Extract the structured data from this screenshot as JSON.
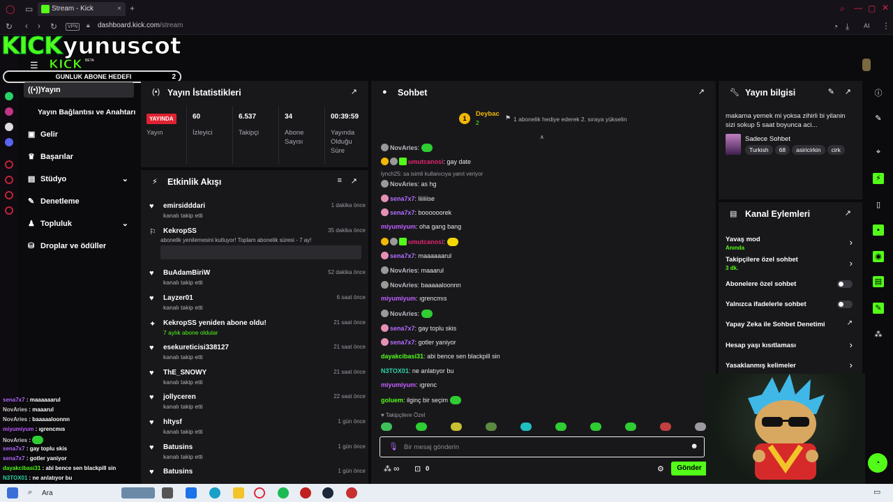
{
  "browser": {
    "tab_title": "Stream - Kick Dashboard",
    "url_domain": "dashboard.kick.com",
    "url_path": "/stream",
    "vpn_label": "VPN",
    "ai_label": "AI"
  },
  "overlay": {
    "logo_text": "KICK",
    "streamer_name": "yunuscot",
    "small_logo": "KICK",
    "beta": "BETA",
    "sub_goal_label": "GUNLUK ABONE HEDEFI",
    "sub_goal_count": "2"
  },
  "sidebar": {
    "items": [
      {
        "label": "Yayın",
        "icon": "broadcast-icon"
      },
      {
        "label": "Yayın Bağlantısı ve Anahtarı",
        "icon": ""
      },
      {
        "label": "Gelir",
        "icon": "money-icon"
      },
      {
        "label": "Başarılar",
        "icon": "trophy-icon"
      },
      {
        "label": "Stüdyo",
        "icon": "studio-icon"
      },
      {
        "label": "Denetleme",
        "icon": "wrench-icon"
      },
      {
        "label": "Topluluk",
        "icon": "community-icon"
      },
      {
        "label": "Droplar ve ödüller",
        "icon": "drops-icon"
      }
    ]
  },
  "stats": {
    "title": "Yayın İstatistikleri",
    "live_badge": "YAYINDA",
    "live_label": "Yayın",
    "viewers": "60",
    "viewers_label": "İzleyici",
    "followers": "6.537",
    "followers_label": "Takipçi",
    "subs": "34",
    "subs_label": "Abone Sayısı",
    "uptime": "00:39:59",
    "uptime_label": "Yayında Olduğu Süre"
  },
  "activity": {
    "title": "Etkinlik Akışı",
    "items": [
      {
        "name": "emirsidddari",
        "sub": "kanalı takip etti",
        "time": "1 dakika önce"
      },
      {
        "name": "KekropSS",
        "sub": "abonelik yenilemesini kutluyor! Toplam abonelik süresi - 7 ay!",
        "time": "35 dakika önce"
      },
      {
        "name": "BuAdamBiriW",
        "sub": "kanalı takip etti",
        "time": "52 dakika önce"
      },
      {
        "name": "Layzer01",
        "sub": "kanalı takip etti",
        "time": "6 saat önce"
      },
      {
        "name": "KekropSS yeniden abone oldu!",
        "sub": "7 aylık abone oldular",
        "time": "21 saat önce"
      },
      {
        "name": "esekureticisi338127",
        "sub": "kanalı takip etti",
        "time": "21 saat önce"
      },
      {
        "name": "ThE_SNOWY",
        "sub": "kanalı takip etti",
        "time": "21 saat önce"
      },
      {
        "name": "jollyceren",
        "sub": "kanalı takip etti",
        "time": "22 saat önce"
      },
      {
        "name": "hltysf",
        "sub": "kanalı takip etti",
        "time": "1 gün önce"
      },
      {
        "name": "Batusins",
        "sub": "kanalı takip etti",
        "time": "1 gün önce"
      },
      {
        "name": "Batusins",
        "sub": "",
        "time": "1 gün önce"
      }
    ]
  },
  "chat": {
    "title": "Sohbet",
    "pinned_user": "Deybac",
    "pinned_count": "2",
    "pinned_rank": "1",
    "pinned_text": "1 abonelik hediye ederek 2. sıraya yükselin",
    "reply_hint": "lynch25: sa isimli kullanıcıya yanıt veriyor",
    "messages": [
      {
        "user": "NovAries",
        "text": "",
        "color": "#b8b8c0"
      },
      {
        "user": "umutcanosi",
        "text": "gay date",
        "color": "#e0256e"
      },
      {
        "user": "NovAries",
        "text": "as hg",
        "color": "#b8b8c0"
      },
      {
        "user": "sena7x7",
        "text": "liiiiiise",
        "color": "#b46cff"
      },
      {
        "user": "sena7x7",
        "text": "boooooorek",
        "color": "#b46cff"
      },
      {
        "user": "miyumiyum",
        "text": "oha gang bang",
        "color": "#c060ff"
      },
      {
        "user": "umutcanosi",
        "text": "",
        "color": "#e0256e"
      },
      {
        "user": "sena7x7",
        "text": "maaaaaarul",
        "color": "#b46cff"
      },
      {
        "user": "NovAries",
        "text": "maaarul",
        "color": "#b8b8c0"
      },
      {
        "user": "NovAries",
        "text": "baaaaaloonnn",
        "color": "#b8b8c0"
      },
      {
        "user": "miyumiyum",
        "text": "ıgrencmıs",
        "color": "#c060ff"
      },
      {
        "user": "NovAries",
        "text": "",
        "color": "#b8b8c0"
      },
      {
        "user": "sena7x7",
        "text": "gay toplu skis",
        "color": "#b46cff"
      },
      {
        "user": "sena7x7",
        "text": "gotler yaniyor",
        "color": "#b46cff"
      },
      {
        "user": "dayakcibasi31",
        "text": "abi bence sen blackpill sin",
        "color": "#53fc18"
      },
      {
        "user": "N3TOX01",
        "text": "ne anlatıyor bu",
        "color": "#2fd4a8"
      },
      {
        "user": "miyumiyum",
        "text": "ıgrenc",
        "color": "#c060ff"
      },
      {
        "user": "goluem",
        "text": "ilginç bir seçim",
        "color": "#53fc18"
      }
    ],
    "followers_only": "Takipçilere Özel",
    "input_placeholder": "Bir mesaj gönderin",
    "points": "0",
    "send_label": "Gönder"
  },
  "stream_info": {
    "title": "Yayın bilgisi",
    "stream_title": "makarna yemek mi yoksa zihirli bi yilanin sizi sokup 5 saat boyunca aci...",
    "category": "Sadece Sohbet",
    "tags": [
      "Turkish",
      "68",
      "asiricirkin",
      "cirk"
    ]
  },
  "channel_actions": {
    "title": "Kanal Eylemleri",
    "slow_mode": "Yavaş mod",
    "slow_mode_sub": "Anında",
    "followers_chat": "Takipçilere özel sohbet",
    "followers_chat_sub": "3 dk.",
    "subs_chat": "Abonelere özel sohbet",
    "emote_chat": "Yalnızca ifadelerle sohbet",
    "ai_mod": "Yapay Zeka ile Sohbet Denetimi",
    "age_limit": "Hesap yaşı kısıtlaması",
    "banned_words": "Yasaklanmış kelimeler"
  },
  "overlay_chat": [
    {
      "user": "sena7x7",
      "text": "maaaaaarul"
    },
    {
      "user": "NovAries",
      "text": "maaarul"
    },
    {
      "user": "NovAries",
      "text": "baaaaaloonnn"
    },
    {
      "user": "miyumiyum",
      "text": "ıgrencmıs"
    },
    {
      "user": "NovAries",
      "text": ""
    },
    {
      "user": "sena7x7",
      "text": "gay toplu skis"
    },
    {
      "user": "sena7x7",
      "text": "gotler yaniyor"
    },
    {
      "user": "dayakcibasi31",
      "text": "abi bence sen blackpill sin"
    },
    {
      "user": "N3TOX01",
      "text": "ne anlatıyor bu"
    }
  ],
  "taskbar": {
    "search": "Ara"
  },
  "colors": {
    "accent": "#53fc18",
    "panel": "#18181b",
    "live": "#e02231"
  }
}
